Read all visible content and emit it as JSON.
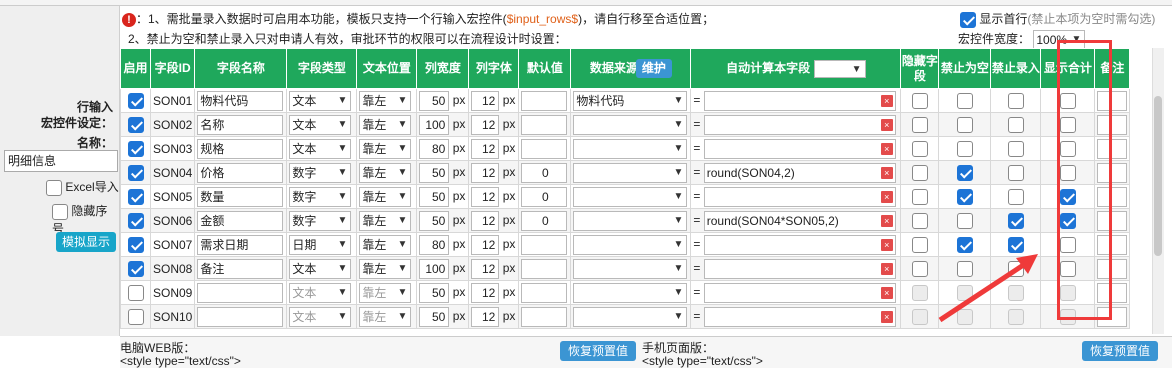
{
  "left_panel": {
    "title_line1": "行输入",
    "title_line2": "宏控件设定：",
    "name_label": "名称：",
    "name_value": "明细信息",
    "excel_import": "Excel导入",
    "hide_seq": "隐藏序号",
    "simulate": "模拟显示"
  },
  "notes": {
    "line1_pre": "：1、需批量录入数据时可启用本功能，模板只支持一个行输入宏控件(",
    "line1_var": "$input_rows$",
    "line1_post": ")，请自行移至合适位置；",
    "line2": "2、禁止为空和禁止录入只对申请人有效，审批环节的权限可以在流程设计时设置：",
    "show_first_row": "显示首行",
    "show_first_row_hint": "(禁止本项为空时需勾选)",
    "width_label": "宏控件宽度：",
    "width_value": "100%"
  },
  "headers": {
    "enable": "启用",
    "field_id": "字段ID",
    "field_name": "字段名称",
    "field_type": "字段类型",
    "text_pos": "文本位置",
    "col_width": "列宽度",
    "col_font": "列字体",
    "default": "默认值",
    "data_source": "数据来源",
    "maintain": "维护",
    "auto_calc": "自动计算本字段",
    "hide_field": "隐藏字段",
    "no_empty": "禁止为空",
    "no_input": "禁止录入",
    "show_total": "显示合计",
    "remark": "备注"
  },
  "rows": [
    {
      "enabled": true,
      "id": "SON01",
      "name": "物料代码",
      "type": "文本",
      "pos": "靠左",
      "width": "50",
      "font": "12",
      "default": "",
      "source": "物料代码",
      "calc": "",
      "hide": false,
      "noempty": false,
      "noinput": false,
      "total": false,
      "active": true
    },
    {
      "enabled": true,
      "id": "SON02",
      "name": "名称",
      "type": "文本",
      "pos": "靠左",
      "width": "100",
      "font": "12",
      "default": "",
      "source": "",
      "calc": "",
      "hide": false,
      "noempty": false,
      "noinput": false,
      "total": false,
      "active": true
    },
    {
      "enabled": true,
      "id": "SON03",
      "name": "规格",
      "type": "文本",
      "pos": "靠左",
      "width": "80",
      "font": "12",
      "default": "",
      "source": "",
      "calc": "",
      "hide": false,
      "noempty": false,
      "noinput": false,
      "total": false,
      "active": true
    },
    {
      "enabled": true,
      "id": "SON04",
      "name": "价格",
      "type": "数字",
      "pos": "靠左",
      "width": "50",
      "font": "12",
      "default": "0",
      "source": "",
      "calc": "round(SON04,2)",
      "hide": false,
      "noempty": true,
      "noinput": false,
      "total": false,
      "active": true
    },
    {
      "enabled": true,
      "id": "SON05",
      "name": "数量",
      "type": "数字",
      "pos": "靠左",
      "width": "50",
      "font": "12",
      "default": "0",
      "source": "",
      "calc": "",
      "hide": false,
      "noempty": true,
      "noinput": false,
      "total": true,
      "active": true
    },
    {
      "enabled": true,
      "id": "SON06",
      "name": "金额",
      "type": "数字",
      "pos": "靠左",
      "width": "50",
      "font": "12",
      "default": "0",
      "source": "",
      "calc": "round(SON04*SON05,2)",
      "hide": false,
      "noempty": false,
      "noinput": true,
      "total": true,
      "active": true
    },
    {
      "enabled": true,
      "id": "SON07",
      "name": "需求日期",
      "type": "日期",
      "pos": "靠左",
      "width": "80",
      "font": "12",
      "default": "",
      "source": "",
      "calc": "",
      "hide": false,
      "noempty": true,
      "noinput": true,
      "total": false,
      "active": true
    },
    {
      "enabled": true,
      "id": "SON08",
      "name": "备注",
      "type": "文本",
      "pos": "靠左",
      "width": "100",
      "font": "12",
      "default": "",
      "source": "",
      "calc": "",
      "hide": false,
      "noempty": false,
      "noinput": false,
      "total": false,
      "active": true
    },
    {
      "enabled": false,
      "id": "SON09",
      "name": "",
      "type": "文本",
      "pos": "靠左",
      "width": "50",
      "font": "12",
      "default": "",
      "source": "",
      "calc": "",
      "hide": false,
      "noempty": false,
      "noinput": false,
      "total": false,
      "active": false
    },
    {
      "enabled": false,
      "id": "SON10",
      "name": "",
      "type": "文本",
      "pos": "靠左",
      "width": "50",
      "font": "12",
      "default": "",
      "source": "",
      "calc": "",
      "hide": false,
      "noempty": false,
      "noinput": false,
      "total": false,
      "active": false
    }
  ],
  "units": {
    "px": "px",
    "eq": "="
  },
  "bottom": {
    "pc_label": "电脑WEB版：",
    "pc_code": "<style type=\"text/css\">",
    "mobile_label": "手机页面版：",
    "mobile_code": "<style type=\"text/css\">",
    "restore": "恢复预置值"
  },
  "colors": {
    "header_green": "#1fa85c",
    "accent_blue": "#1d74d6",
    "highlight_red": "#ef3a3a"
  }
}
